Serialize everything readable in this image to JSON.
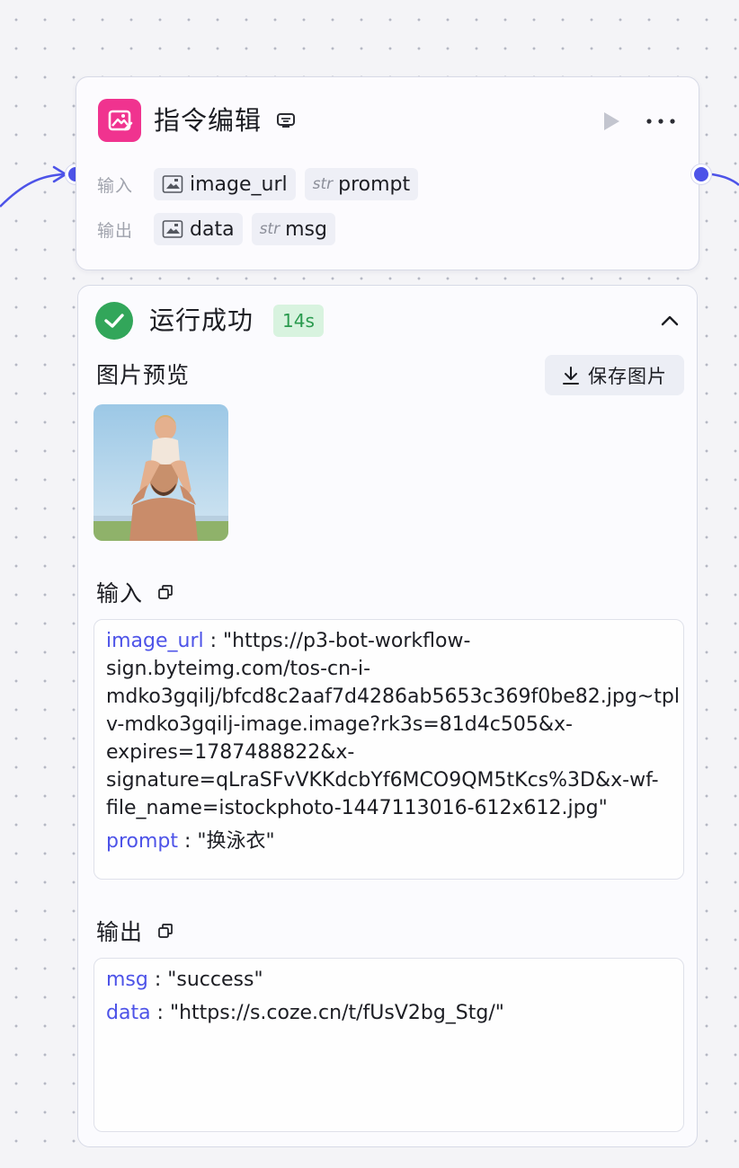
{
  "node": {
    "title": "指令编辑",
    "inputs_label": "输入",
    "outputs_label": "输出",
    "inputs": [
      {
        "type_icon": "image-icon",
        "name": "image_url"
      },
      {
        "type_icon": "str",
        "name": "prompt"
      }
    ],
    "outputs": [
      {
        "type_icon": "image-icon",
        "name": "data"
      },
      {
        "type_icon": "str",
        "name": "msg"
      }
    ],
    "icon": "image-edit-icon",
    "accent_color": "#f0338f",
    "port_color": "#4d53e8"
  },
  "result": {
    "status": "运行成功",
    "duration": "14s",
    "preview_title": "图片预览",
    "save_button": "保存图片",
    "input_section_title": "输入",
    "output_section_title": "输出",
    "input_params": {
      "image_url_key": "image_url",
      "image_url_lines": [
        "\"https://p3-bot-workflow-",
        "sign.byteimg.com/tos-cn-i-",
        "mdko3gqilj/bfcd8c2aaf7d4286ab5653c369f0be82.jpg~tpl",
        "v-mdko3gqilj-image.image?rk3s=81d4c505&x-",
        "expires=1787488822&x-",
        "signature=qLraSFvVKKdcbYf6MCO9QM5tKcs%3D&x-wf-",
        "file_name=istockphoto-1447113016-612x612.jpg\""
      ],
      "prompt_key": "prompt",
      "prompt_value": "\"换泳衣\""
    },
    "output_params": {
      "msg_key": "msg",
      "msg_value": "\"success\"",
      "data_key": "data",
      "data_value": "\"https://s.coze.cn/t/fUsV2bg_Stg/\""
    },
    "success_color": "#32a65a",
    "key_color": "#4d53e8"
  },
  "separator": " : "
}
